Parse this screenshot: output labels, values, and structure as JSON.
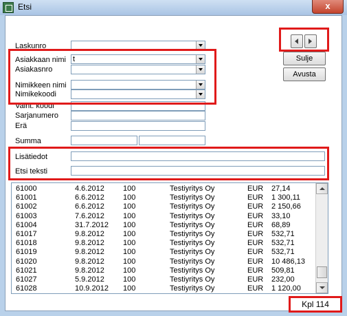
{
  "window": {
    "title": "Etsi",
    "close_glyph": "x"
  },
  "form": {
    "laskunro_label": "Laskunro",
    "asiakkaan_nimi_label": "Asiakkaan nimi",
    "asiakkaan_nimi_value": "t",
    "asiakasnro_label": "Asiakasnro",
    "nimikkeen_nimi_label": "Nimikkeen nimi",
    "nimikekoodi_label": "Nimikekoodi",
    "vaiht_koodi_label": "Vaiht. koodi",
    "sarjanumero_label": "Sarjanumero",
    "era_label": "Erä",
    "summa_label": "Summa",
    "lisatiedot_label": "Lisätiedot",
    "etsi_teksti_label": "Etsi teksti"
  },
  "buttons": {
    "sulje": "Sulje",
    "avusta": "Avusta",
    "prev_icon": "arrow-left-icon",
    "next_icon": "arrow-right-icon"
  },
  "results": [
    {
      "nro": "61000",
      "date": "4.6.2012",
      "code": "100",
      "customer": "Testiyritys Oy",
      "currency": "EUR",
      "amount": "27,14"
    },
    {
      "nro": "61001",
      "date": "6.6.2012",
      "code": "100",
      "customer": "Testiyritys Oy",
      "currency": "EUR",
      "amount": "1 300,11"
    },
    {
      "nro": "61002",
      "date": "6.6.2012",
      "code": "100",
      "customer": "Testiyritys Oy",
      "currency": "EUR",
      "amount": "2 150,66"
    },
    {
      "nro": "61003",
      "date": "7.6.2012",
      "code": "100",
      "customer": "Testiyritys Oy",
      "currency": "EUR",
      "amount": "33,10"
    },
    {
      "nro": "61004",
      "date": "31.7.2012",
      "code": "100",
      "customer": "Testiyritys Oy",
      "currency": "EUR",
      "amount": "68,89"
    },
    {
      "nro": "61017",
      "date": "9.8.2012",
      "code": "100",
      "customer": "Testiyritys Oy",
      "currency": "EUR",
      "amount": "532,71"
    },
    {
      "nro": "61018",
      "date": "9.8.2012",
      "code": "100",
      "customer": "Testiyritys Oy",
      "currency": "EUR",
      "amount": "532,71"
    },
    {
      "nro": "61019",
      "date": "9.8.2012",
      "code": "100",
      "customer": "Testiyritys Oy",
      "currency": "EUR",
      "amount": "532,71"
    },
    {
      "nro": "61020",
      "date": "9.8.2012",
      "code": "100",
      "customer": "Testiyritys Oy",
      "currency": "EUR",
      "amount": "10 486,13"
    },
    {
      "nro": "61021",
      "date": "9.8.2012",
      "code": "100",
      "customer": "Testiyritys Oy",
      "currency": "EUR",
      "amount": "509,81"
    },
    {
      "nro": "61027",
      "date": "5.9.2012",
      "code": "100",
      "customer": "Testiyritys Oy",
      "currency": "EUR",
      "amount": "232,00"
    },
    {
      "nro": "61028",
      "date": "10.9.2012",
      "code": "100",
      "customer": "Testiyritys Oy",
      "currency": "EUR",
      "amount": "1 120,00"
    }
  ],
  "status": {
    "count_text": "Kpl 114"
  },
  "colors": {
    "highlight": "#e01a1a",
    "titlebar": "#b9d1ea"
  }
}
